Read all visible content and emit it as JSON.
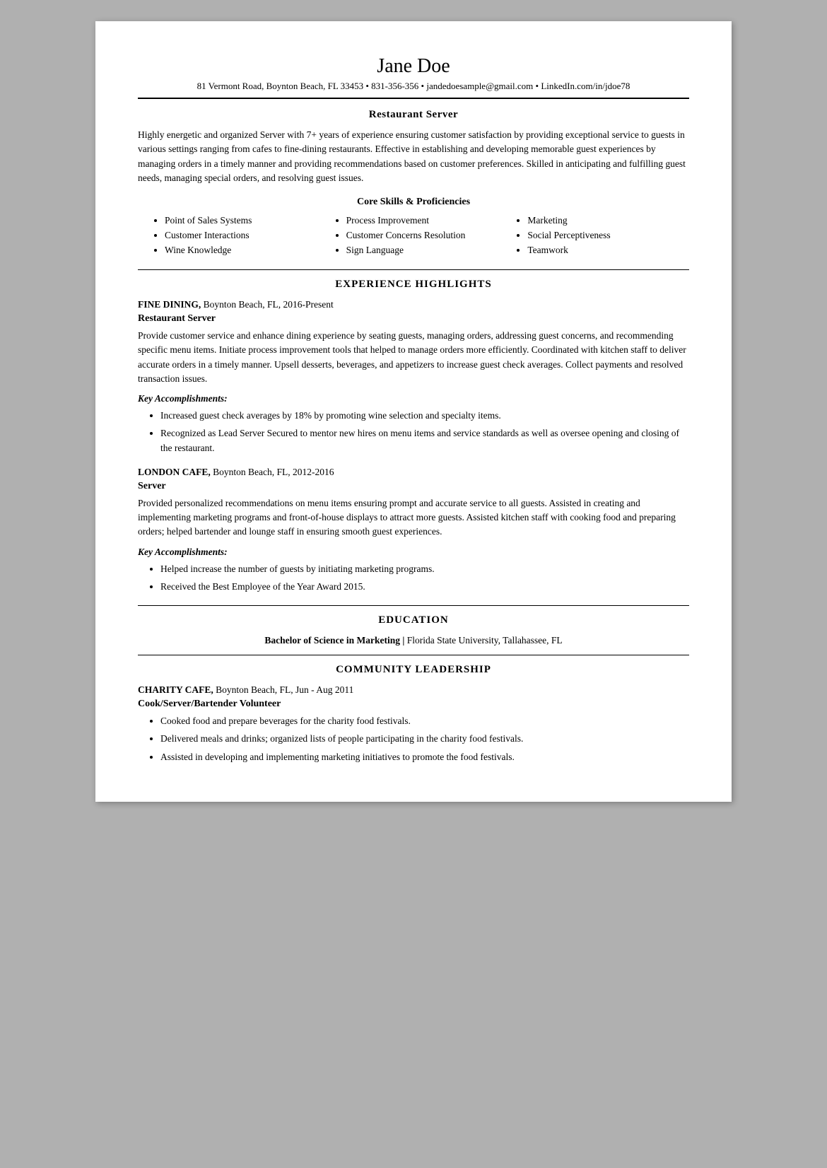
{
  "header": {
    "name": "Jane Doe",
    "contact": "81 Vermont Road, Boynton Beach, FL 33453 • 831-356-356 • jandedoesample@gmail.com • LinkedIn.com/in/jdoe78"
  },
  "resume_title": "Restaurant Server",
  "summary": "Highly energetic and organized Server with 7+ years of experience ensuring customer satisfaction by providing exceptional service to guests in various settings ranging from cafes to fine-dining restaurants. Effective in establishing and developing memorable guest experiences by managing orders in a timely manner and providing recommendations based on customer preferences. Skilled in anticipating and fulfilling guest needs, managing special orders, and resolving guest issues.",
  "skills": {
    "heading": "Core Skills & Proficiencies",
    "col1": [
      "Point of Sales Systems",
      "Customer Interactions",
      "Wine Knowledge"
    ],
    "col2": [
      "Process Improvement",
      "Customer Concerns Resolution",
      "Sign Language"
    ],
    "col3": [
      "Marketing",
      "Social Perceptiveness",
      "Teamwork"
    ]
  },
  "experience": {
    "section_title": "EXPERIENCE HIGHLIGHTS",
    "jobs": [
      {
        "employer": "FINE DINING,",
        "location_dates": " Boynton Beach, FL, 2016-Present",
        "title": "Restaurant Server",
        "description": "Provide customer service and enhance dining experience by seating guests, managing orders, addressing guest concerns, and recommending specific menu items. Initiate process improvement tools that helped to manage orders more efficiently. Coordinated with kitchen staff to deliver accurate orders in a timely manner. Upsell desserts, beverages, and appetizers to increase guest check averages. Collect payments and resolved transaction issues.",
        "key_acc_label": "Key Accomplishments:",
        "accomplishments": [
          "Increased guest check averages by 18% by promoting wine selection and specialty items.",
          "Recognized as Lead Server Secured to mentor new hires on menu items and service standards as well as oversee opening and closing of the restaurant."
        ]
      },
      {
        "employer": "LONDON CAFE,",
        "location_dates": " Boynton Beach, FL, 2012-2016",
        "title": "Server",
        "description": "Provided personalized recommendations on menu items ensuring prompt and accurate service to all guests. Assisted in creating and implementing marketing programs and front-of-house displays to attract more guests. Assisted kitchen staff with cooking food and preparing orders; helped bartender and lounge staff in ensuring smooth guest experiences.",
        "key_acc_label": "Key Accomplishments:",
        "accomplishments": [
          "Helped increase the number of guests by initiating marketing programs.",
          "Received the Best Employee of the Year Award 2015."
        ]
      }
    ]
  },
  "education": {
    "section_title": "EDUCATION",
    "degree_bold": "Bachelor of Science in Marketing |",
    "degree_rest": " Florida State University, Tallahassee, FL"
  },
  "community": {
    "section_title": "COMMUNITY LEADERSHIP",
    "employer": "CHARITY CAFE,",
    "location_dates": " Boynton Beach, FL, Jun - Aug 2011",
    "title": "Cook/Server/Bartender Volunteer",
    "items": [
      "Cooked food and prepare beverages for the charity food festivals.",
      "Delivered meals and drinks; organized lists of people participating in the charity food festivals.",
      "Assisted in developing and implementing marketing initiatives to promote the food festivals."
    ]
  }
}
